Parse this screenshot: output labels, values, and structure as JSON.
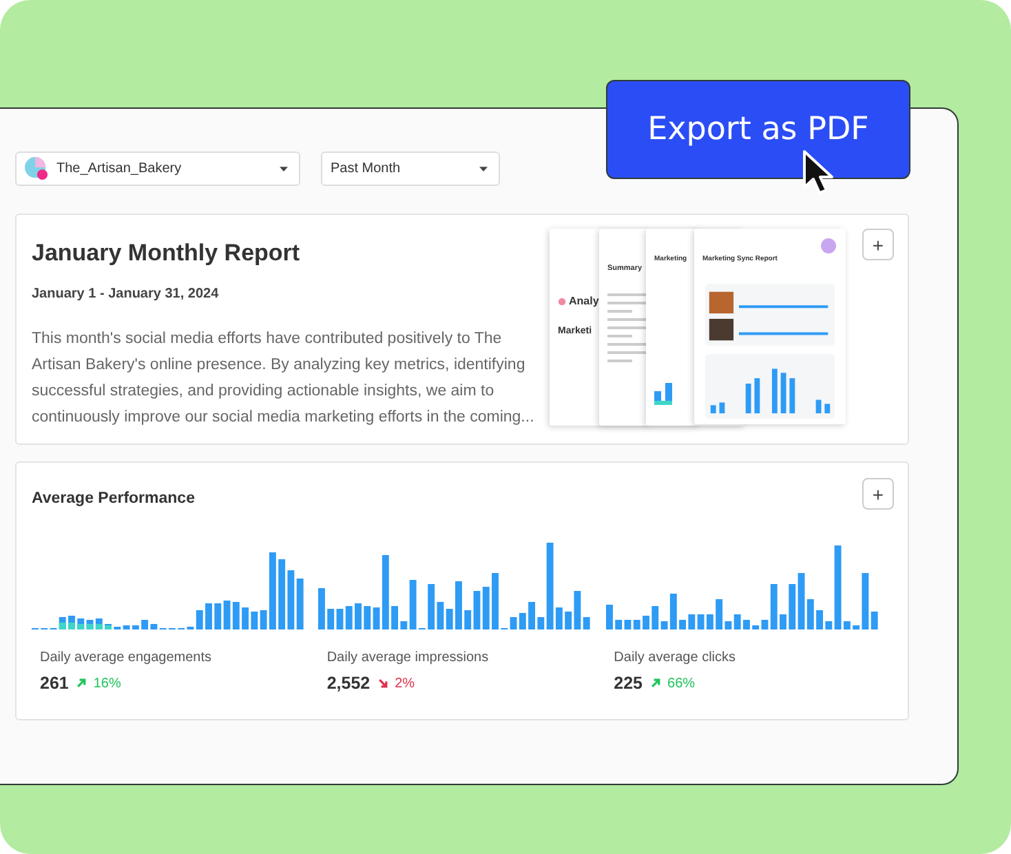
{
  "filters": [
    {
      "kind": "account",
      "value": "The_Artisan_Bakery"
    },
    {
      "kind": "plain",
      "value": "Past Month"
    }
  ],
  "export_button": {
    "label": "Export as PDF"
  },
  "report": {
    "title": "January Monthly Report",
    "date_range": "January 1 - January 31, 2024",
    "summary": "This month's social media efforts have contributed positively to The Artisan Bakery's online presence. By analyzing key metrics, identifying successful strategies, and providing actionable insights, we aim to continuously improve our social media marketing efforts in the coming...",
    "add_button": "+",
    "pages": [
      {
        "kind": "cover",
        "title": "Analy",
        "subtitle": "Marketi"
      },
      {
        "kind": "summary",
        "title": "Summary"
      },
      {
        "kind": "chart",
        "title": "Marketing"
      },
      {
        "kind": "posts",
        "title": "Marketing Sync Report"
      }
    ]
  },
  "performance": {
    "title": "Average Performance",
    "add_button": "+",
    "metrics": [
      {
        "label": "Daily average engagements",
        "value": "261",
        "change": "16%",
        "kind": "up"
      },
      {
        "label": "Daily average impressions",
        "value": "2,552",
        "change": "2%",
        "kind": "down"
      },
      {
        "label": "Daily average clicks",
        "value": "225",
        "change": "66%",
        "kind": "up"
      }
    ]
  }
}
